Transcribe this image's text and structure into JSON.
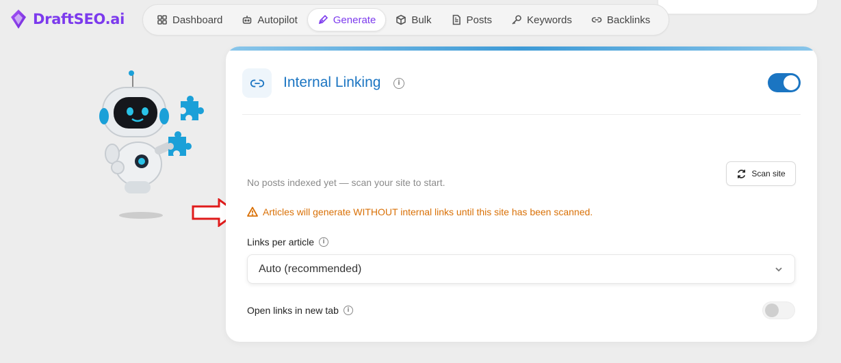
{
  "brand": {
    "name": "DraftSEO.ai",
    "color": "#7c3aed"
  },
  "nav": {
    "items": [
      {
        "label": "Dashboard",
        "icon": "grid-icon"
      },
      {
        "label": "Autopilot",
        "icon": "robot-icon"
      },
      {
        "label": "Generate",
        "icon": "pen-icon",
        "active": true
      },
      {
        "label": "Bulk",
        "icon": "box-icon"
      },
      {
        "label": "Posts",
        "icon": "document-icon"
      },
      {
        "label": "Keywords",
        "icon": "key-icon"
      },
      {
        "label": "Backlinks",
        "icon": "link-icon"
      }
    ]
  },
  "card": {
    "title": "Internal Linking",
    "enabled": true,
    "accent": "#1b75c2",
    "scan_button": "Scan site",
    "status_text": "No posts indexed yet — scan your site to start.",
    "warning_text": "Articles will generate WITHOUT internal links until this site has been scanned.",
    "warning_color": "#d97006",
    "links_per_article_label": "Links per article",
    "links_per_article_value": "Auto (recommended)",
    "open_new_tab_label": "Open links in new tab",
    "open_new_tab_enabled": false
  }
}
